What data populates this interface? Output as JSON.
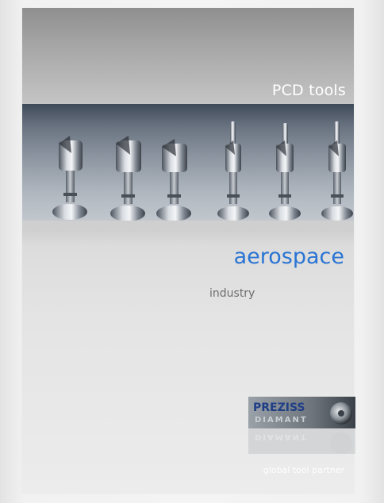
{
  "header": {
    "category": "PCD tools"
  },
  "main": {
    "title": "aerospace",
    "subtitle": "industry"
  },
  "logo": {
    "line1": "PREZISS",
    "line2": "DIAMANT"
  },
  "footer": {
    "tagline": "global tool partner"
  },
  "colors": {
    "title": "#2a74d3",
    "subtitle": "#6e6e6e",
    "tagline": "#ffffff"
  }
}
